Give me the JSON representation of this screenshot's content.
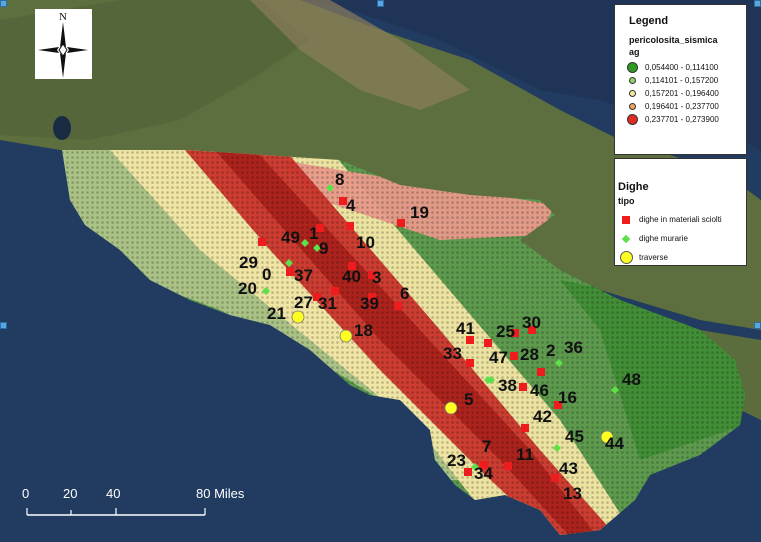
{
  "north": {
    "letter": "N",
    "icon": "north-arrow-icon"
  },
  "legend_seismic": {
    "title": "Legend",
    "layer": "pericolosita_sismica",
    "field": "ag",
    "classes": [
      {
        "label": "0,054400 - 0,114100",
        "color": "#2e9a22"
      },
      {
        "label": "0,114101 - 0,157200",
        "color": "#8fd36a"
      },
      {
        "label": "0,157201 - 0,196400",
        "color": "#f3eaa0"
      },
      {
        "label": "0,196401 - 0,237700",
        "color": "#f0a35a"
      },
      {
        "label": "0,237701 - 0,273900",
        "color": "#e02a22"
      }
    ]
  },
  "legend_dams": {
    "title": "Dighe",
    "field": "tipo",
    "items": [
      {
        "label": "dighe in materiali sciolti",
        "color": "#ee1c1c",
        "shape": "square"
      },
      {
        "label": "dighe murarie",
        "color": "#5de04a",
        "shape": "diamond"
      },
      {
        "label": "traverse",
        "color": "#ffff22",
        "shape": "circle"
      }
    ]
  },
  "scale": {
    "ticks": [
      "0",
      "20",
      "40",
      "80 Miles"
    ]
  },
  "dams": [
    {
      "id": "8",
      "type": "diamond"
    },
    {
      "id": "4",
      "type": "square"
    },
    {
      "id": "19",
      "type": "square"
    },
    {
      "id": "1",
      "type": "square"
    },
    {
      "id": "49",
      "type": "diamond"
    },
    {
      "id": "9",
      "type": "diamond"
    },
    {
      "id": "10",
      "type": "square"
    },
    {
      "id": "29",
      "type": "square"
    },
    {
      "id": "0",
      "type": "diamond"
    },
    {
      "id": "37",
      "type": "square"
    },
    {
      "id": "40",
      "type": "square"
    },
    {
      "id": "3",
      "type": "square"
    },
    {
      "id": "20",
      "type": "diamond"
    },
    {
      "id": "27",
      "type": "square"
    },
    {
      "id": "31",
      "type": "square"
    },
    {
      "id": "39",
      "type": "square"
    },
    {
      "id": "6",
      "type": "square"
    },
    {
      "id": "21",
      "type": "circle"
    },
    {
      "id": "18",
      "type": "circle"
    },
    {
      "id": "41",
      "type": "square"
    },
    {
      "id": "25",
      "type": "square"
    },
    {
      "id": "30",
      "type": "square"
    },
    {
      "id": "36",
      "type": "diamond"
    },
    {
      "id": "33",
      "type": "square"
    },
    {
      "id": "47",
      "type": "square"
    },
    {
      "id": "28",
      "type": "square"
    },
    {
      "id": "2",
      "type": "square"
    },
    {
      "id": "48",
      "type": "diamond"
    },
    {
      "id": "38",
      "type": "diamond"
    },
    {
      "id": "46",
      "type": "square"
    },
    {
      "id": "16",
      "type": "square"
    },
    {
      "id": "5",
      "type": "diamond"
    },
    {
      "id": "42",
      "type": "square"
    },
    {
      "id": "45",
      "type": "diamond"
    },
    {
      "id": "44",
      "type": "circle"
    },
    {
      "id": "7",
      "type": "diamond"
    },
    {
      "id": "11",
      "type": "square"
    },
    {
      "id": "23",
      "type": "square"
    },
    {
      "id": "34",
      "type": "square"
    },
    {
      "id": "43",
      "type": "square"
    },
    {
      "id": "13",
      "type": "square"
    },
    {
      "id": "",
      "type": "circle"
    }
  ]
}
